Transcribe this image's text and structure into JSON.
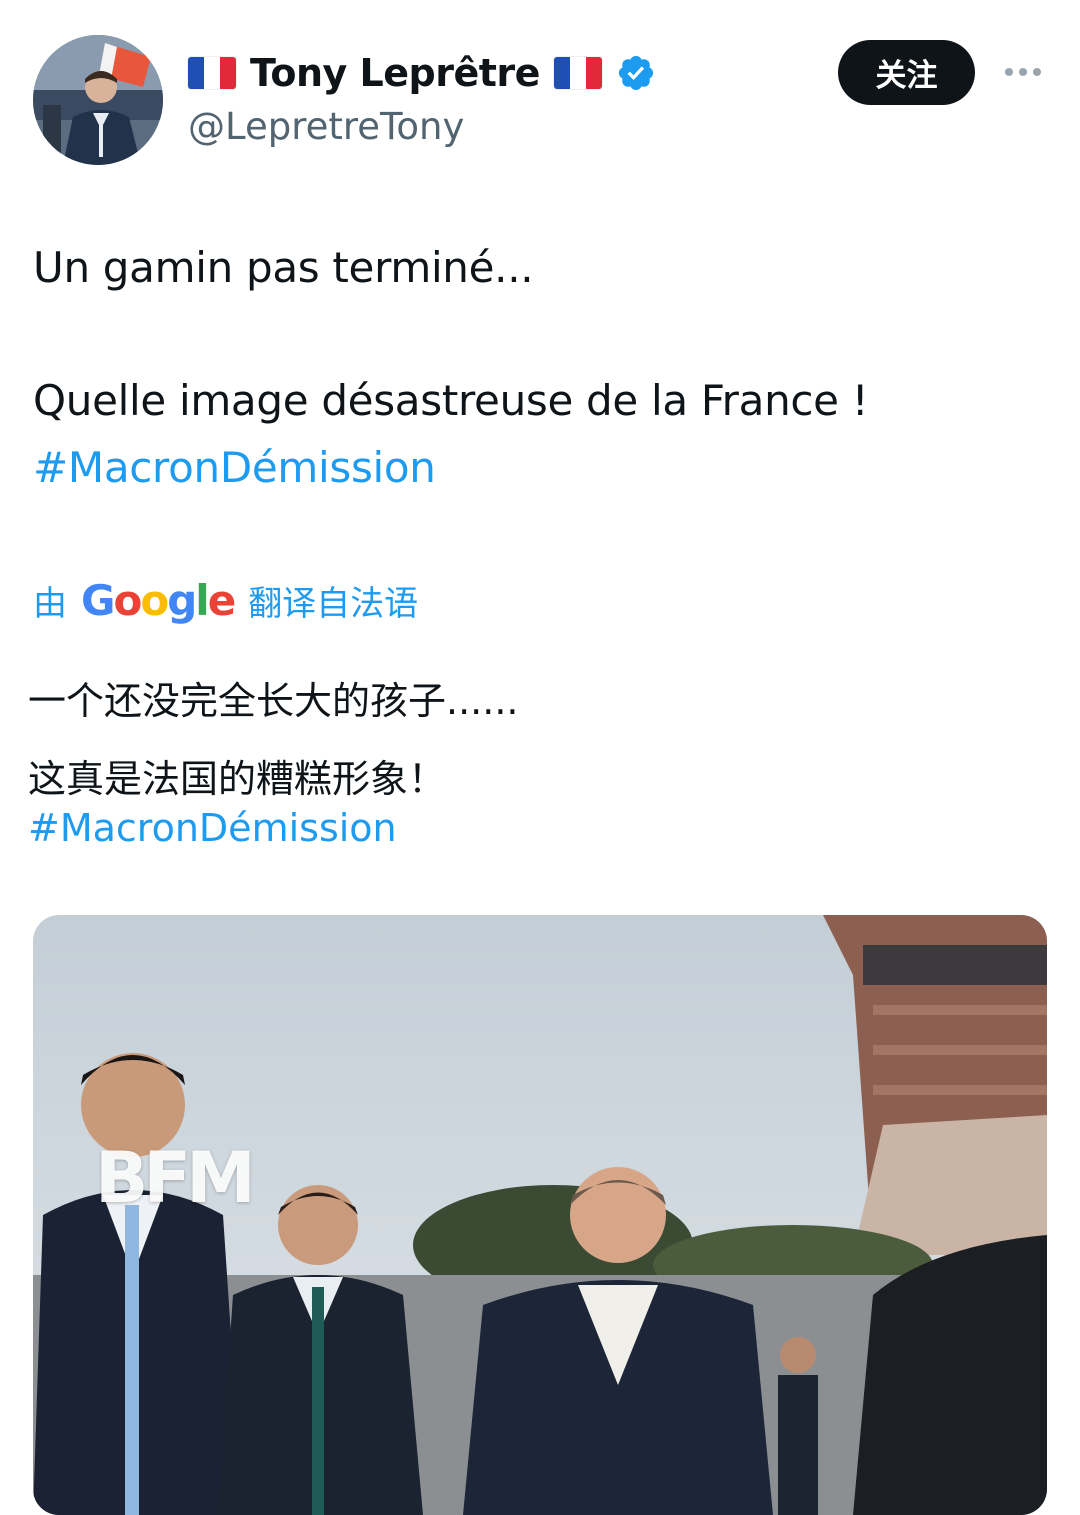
{
  "header": {
    "display_name": "Tony Leprêtre",
    "handle": "@LepretreTony",
    "follow_label": "关注",
    "flag_icon": "france-flag-icon",
    "verified_color": "#1d9bf0"
  },
  "tweet": {
    "line1": "Un gamin pas terminé...",
    "line2": "Quelle image désastreuse de la France !",
    "hashtag": "#MacronDémission"
  },
  "translation": {
    "by_label": "由",
    "provider": "Google",
    "from_label": "翻译自法语",
    "line1": "一个还没完全长大的孩子......",
    "line2": "这真是法国的糟糕形象！",
    "hashtag": "#MacronDémission"
  },
  "media": {
    "watermark": "BFM"
  },
  "colors": {
    "accent": "#1d9bf0",
    "text": "#0f1419",
    "muted": "#536471"
  }
}
